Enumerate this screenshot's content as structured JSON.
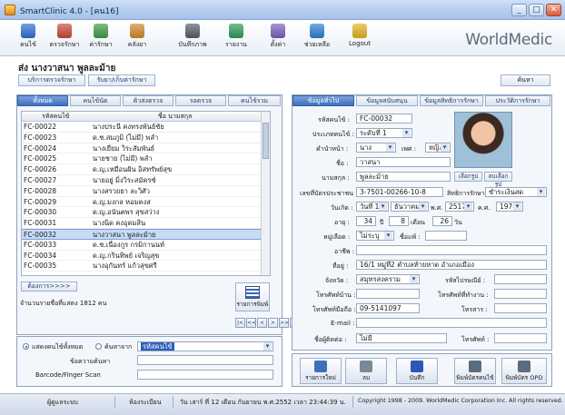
{
  "window": {
    "title": "SmartClinic 4.0 - [คน16]",
    "minimize": "_",
    "maximize": "□",
    "close": "✕"
  },
  "toolbar": {
    "items": [
      {
        "label": "คนไข้",
        "icon": "patient-icon",
        "color": "#2f6fd1"
      },
      {
        "label": "ตรวจรักษา",
        "icon": "stethoscope-icon",
        "color": "#c84a3a"
      },
      {
        "label": "ค่ารักษา",
        "icon": "money-icon",
        "color": "#3e9b48"
      },
      {
        "label": "คลังยา",
        "icon": "medicine-icon",
        "color": "#d08a2a"
      },
      {
        "label": "บันทึกภาพ",
        "icon": "camera-icon",
        "color": "#555e6a"
      },
      {
        "label": "รายงาน",
        "icon": "report-chart-icon",
        "color": "#2f9a5c"
      },
      {
        "label": "ตั้งค่า",
        "icon": "settings-icon",
        "color": "#7a5fc0"
      },
      {
        "label": "ช่วยเหลือ",
        "icon": "help-icon",
        "color": "#2d7fd6"
      },
      {
        "label": "Logout",
        "icon": "lock-icon",
        "color": "#e2b320"
      }
    ],
    "brand": "WorldMedic"
  },
  "patient_header": {
    "name": "ส่ง นางวาสนา พูลละม้าย",
    "tab_treat": "บริการตรวจรักษา",
    "tab_queue": "รับยา/เก็บค่ารักษา",
    "search_button": "ค้นหา"
  },
  "left": {
    "tabs": [
      "ทั้งหมด",
      "คนไข้นัด",
      "คิวส่งตรวจ",
      "รอตรวจ",
      "คนไข้รวม"
    ],
    "columns": {
      "code": "รหัสคนไข้",
      "name": "ชื่อ นามสกุล"
    },
    "rows": [
      {
        "code": "FC-00022",
        "name": "นางประนี คงทรงพันธ์ชัย"
      },
      {
        "code": "FC-00023",
        "name": "ด.ช.สมภูมิ (ไม่มี) พลำ"
      },
      {
        "code": "FC-00024",
        "name": "นางเยี่ยม วิระสัมพันธ์"
      },
      {
        "code": "FC-00025",
        "name": "นายชาย (ไม่มี) พลำ"
      },
      {
        "code": "FC-00026",
        "name": "ด.ญ.เหมือนฝัน อิสทรัพย์สุข"
      },
      {
        "code": "FC-00027",
        "name": "นายอยู่ มิ่งวิระสมัครซ์"
      },
      {
        "code": "FC-00028",
        "name": "นางสรวยยา ละวิศัว"
      },
      {
        "code": "FC-00029",
        "name": "ด.ญ.มงกล หอมคงส"
      },
      {
        "code": "FC-00030",
        "name": "ด.ญ.อนันตพร สุขสว่าง"
      },
      {
        "code": "FC-00031",
        "name": "นางนิด คงอุดมสิน"
      },
      {
        "code": "FC-00032",
        "name": "นางวาสนา พูลละม้าย",
        "selected": true
      },
      {
        "code": "FC-00033",
        "name": "ด.ช.เนื่องกูร กรมิกานนท์"
      },
      {
        "code": "FC-00034",
        "name": "ด.ญ.กรินทิพย์ เจริญสุข"
      },
      {
        "code": "FC-00035",
        "name": "นางอุกันทร์ แก้วสุขศรี"
      }
    ],
    "more_button": "ต้องการ>>>>",
    "count_text": "จำนวนรายชื่อที่แสดง 1812 คน",
    "table_button": "รายการพิมพ์",
    "pager": [
      "|<",
      "<<",
      "<",
      ">",
      ">>",
      ">|"
    ],
    "search": {
      "radio_show_all": "แสดงคนไข้ทั้งหมด",
      "radio_search": "ค้นหาจาก",
      "search_by_value": "รหัสคนไข้",
      "keyword_label": "ข้อความค้นหา",
      "barcode_label": "Barcode/Finger Scan"
    }
  },
  "right": {
    "tabs": [
      "ข้อมูลทั่วไป",
      "ข้อมูลสนับสนุน",
      "ข้อมูลสิทธิการรักษา",
      "ประวัติการรักษา"
    ],
    "form": {
      "patient_code": {
        "label": "รหัสคนไข้ :",
        "value": "FC-00032"
      },
      "patient_type": {
        "label": "ประเภทคนไข้ :",
        "value": "ระดับที่ 1"
      },
      "prefix": {
        "label": "คำนำหน้า :",
        "value": "นาง"
      },
      "sex": {
        "label": "เพศ :",
        "value": "หญิง"
      },
      "first_name": {
        "label": "ชื่อ :",
        "value": "วาสนา"
      },
      "last_name": {
        "label": "นามสกุล :",
        "value": "พูลละม้าย"
      },
      "select_photo": "เลือกรูป",
      "delete_photo": "ลบเลือกรูป",
      "id_card": {
        "label": "เลขที่บัตรประชาชน :",
        "value": "3-7501-00266-10-8"
      },
      "rights": {
        "label": "สิทธิการรักษา :",
        "value": "ชำระเงินสด"
      },
      "birth": {
        "label": "วันเกิด :",
        "day": "วันที่ 17",
        "month": "ธันวาคม",
        "era": "พ.ศ.",
        "year": "2517",
        "era2": "ค.ศ.",
        "year2": "1974"
      },
      "age": {
        "label": "อายุ :",
        "years": "34",
        "years_unit": "ปี",
        "months": "8",
        "months_unit": "เดือน",
        "days": "26",
        "days_unit": "วัน"
      },
      "blood": {
        "label": "หมู่เลือด :",
        "value": "ไม่ระบุ"
      },
      "allergy": {
        "label": "ชื่อแพ้ :",
        "value": ""
      },
      "occupation": {
        "label": "อาชีพ :",
        "value": ""
      },
      "address": {
        "label": "ที่อยู่ :",
        "value": "16/1 หมู่ที่2 ตำบลท้ายหาด อำเภอเมือง"
      },
      "province": {
        "label": "จังหวัด :",
        "value": "สมุทรสงคราม"
      },
      "postcode": {
        "label": "รหัสไปรษณีย์ :",
        "value": ""
      },
      "home_phone": {
        "label": "โทรศัพท์บ้าน :",
        "value": ""
      },
      "work_phone": {
        "label": "โทรศัพท์ที่ทำงาน :",
        "value": ""
      },
      "mobile": {
        "label": "โทรศัพท์มือถือ :",
        "value": "09-5141097"
      },
      "fax": {
        "label": "โทรสาร :",
        "value": ""
      },
      "email": {
        "label": "E-mail :",
        "value": ""
      },
      "contact": {
        "label": "ชื่อผู้ติดต่อ :",
        "value": "ไม่มี"
      },
      "contact_phone": {
        "label": "โทรศัพท์ :",
        "value": ""
      }
    },
    "actions": [
      {
        "label": "รายการใหม่",
        "icon": "new-record-icon",
        "color": "#3e6fbe"
      },
      {
        "label": "ลบ",
        "icon": "delete-icon",
        "color": "#7b8896"
      },
      {
        "label": "บันทึก",
        "icon": "save-icon",
        "color": "#2b57b5"
      },
      {
        "label": "พิมพ์บัตรคนไข้",
        "icon": "print-card-icon",
        "color": "#5b6b80"
      },
      {
        "label": "พิมพ์บัตร OPD",
        "icon": "print-opd-icon",
        "color": "#5b6b80"
      }
    ]
  },
  "status": {
    "user": "ผู้ดูแลระบบ",
    "room": "ห้องระเบียน",
    "datetime": "วัน เสาร์ ที่ 12 เดือน กันยายน พ.ศ.2552 เวลา 23:44:39 น.",
    "copyright": "Copyright 1998 - 2009. WorldMedic Corporation Inc. All rights reserved."
  }
}
